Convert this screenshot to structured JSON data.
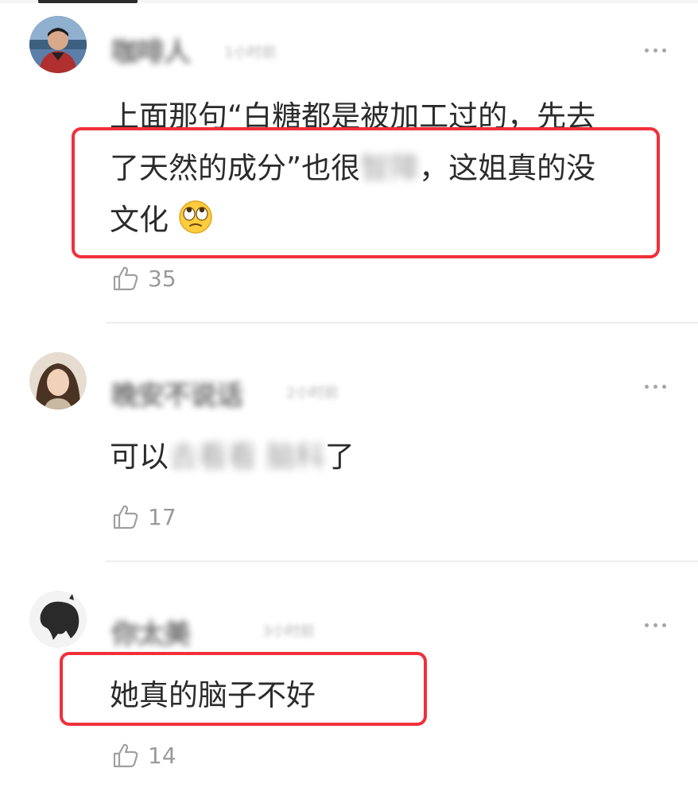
{
  "comments": [
    {
      "username": "咖啡人",
      "timestamp": "1小时前",
      "content_line1": "上面那句“白糖都是被加工过的，先去",
      "content_line2_a": "了天然的成分”也很",
      "content_line2_blur": "智障",
      "content_line2_b": "，这姐真的没",
      "content_line3": "文化",
      "emoji": "eye-roll-emoji",
      "likes": "35",
      "highlighted": true
    },
    {
      "username": "晚安不说话",
      "timestamp": "2小时前",
      "content_a": "可以",
      "content_blur1": "去看看",
      "content_blur2": "脑科",
      "content_b": "了",
      "likes": "17",
      "highlighted": false
    },
    {
      "username": "你太美",
      "timestamp": "3小时前",
      "content": "她真的脑子不好",
      "likes": "14",
      "highlighted": true
    }
  ],
  "icons": {
    "like": "thumbs-up-icon",
    "more": "more-dots-icon"
  },
  "colors": {
    "highlight_border": "#f0303a",
    "text": "#2b2b2b",
    "muted": "#9a9a9a"
  }
}
